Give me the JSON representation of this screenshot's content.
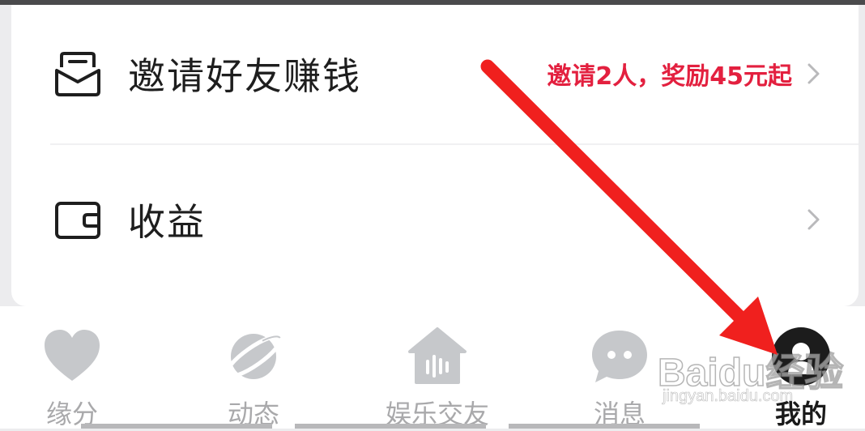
{
  "menu": {
    "invite": {
      "label": "邀请好友赚钱",
      "promo": "邀请2人，奖励45元起",
      "icon": "envelope-icon"
    },
    "earnings": {
      "label": "收益",
      "icon": "wallet-icon"
    }
  },
  "tabs": [
    {
      "label": "缘分",
      "icon": "heart-icon"
    },
    {
      "label": "动态",
      "icon": "planet-icon"
    },
    {
      "label": "娱乐交友",
      "icon": "voice-room-icon"
    },
    {
      "label": "消息",
      "icon": "chat-bubble-icon"
    },
    {
      "label": "我的",
      "icon": "profile-icon",
      "active": true
    }
  ],
  "watermark": {
    "brand": "Baidu经验",
    "url": "jingyan.baidu.com"
  },
  "colors": {
    "promo": "#e3203f",
    "tab_inactive": "#a9a9ab",
    "tab_active": "#1a1a1a",
    "annotation_arrow": "#f0201e"
  }
}
